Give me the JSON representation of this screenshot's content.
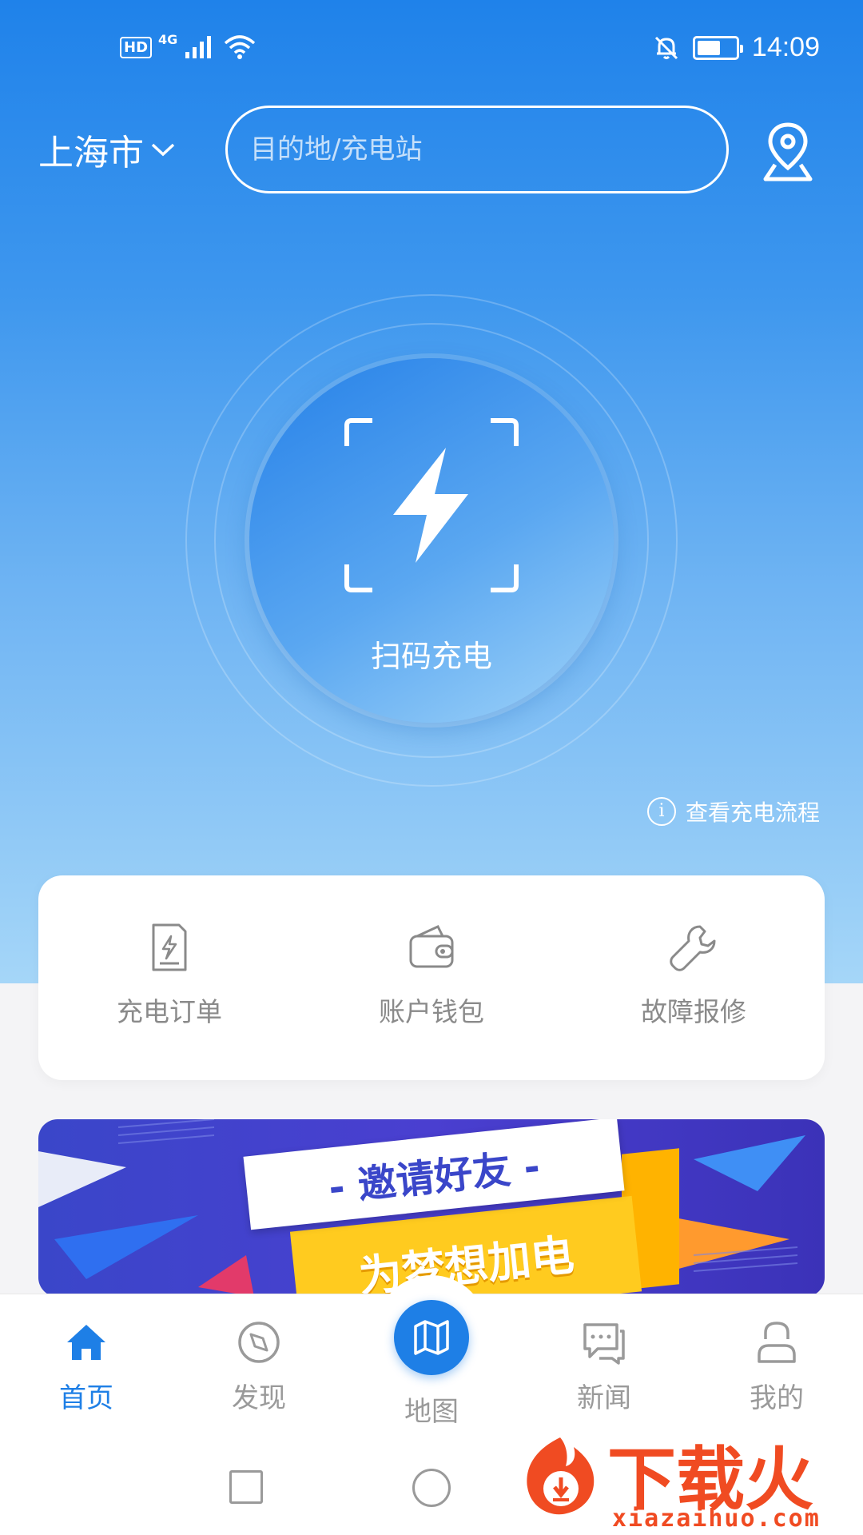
{
  "status_bar": {
    "hd": "HD",
    "network": "4G",
    "time": "14:09",
    "battery_level": 0.6
  },
  "header": {
    "city": "上海市",
    "search_placeholder": "目的地/充电站"
  },
  "scan": {
    "label": "扫码充电"
  },
  "flow_link": {
    "label": "查看充电流程"
  },
  "quick_actions": [
    {
      "label": "充电订单",
      "icon": "charging-order-icon"
    },
    {
      "label": "账户钱包",
      "icon": "wallet-icon"
    },
    {
      "label": "故障报修",
      "icon": "wrench-icon"
    }
  ],
  "banner": {
    "title": "- 邀请好友 -",
    "subtitle": "为梦想加电"
  },
  "bottom_nav": [
    {
      "label": "首页",
      "icon": "home-icon",
      "active": true
    },
    {
      "label": "发现",
      "icon": "compass-icon",
      "active": false
    },
    {
      "label": "地图",
      "icon": "map-icon",
      "active": false
    },
    {
      "label": "新闻",
      "icon": "chat-icon",
      "active": false
    },
    {
      "label": "我的",
      "icon": "user-icon",
      "active": false
    }
  ],
  "watermark": {
    "brand": "下载火",
    "domain": "xiazaihuo.com"
  },
  "colors": {
    "primary": "#1e7fe6",
    "nav_inactive": "#9a9a9a",
    "watermark": "#f04b22"
  }
}
